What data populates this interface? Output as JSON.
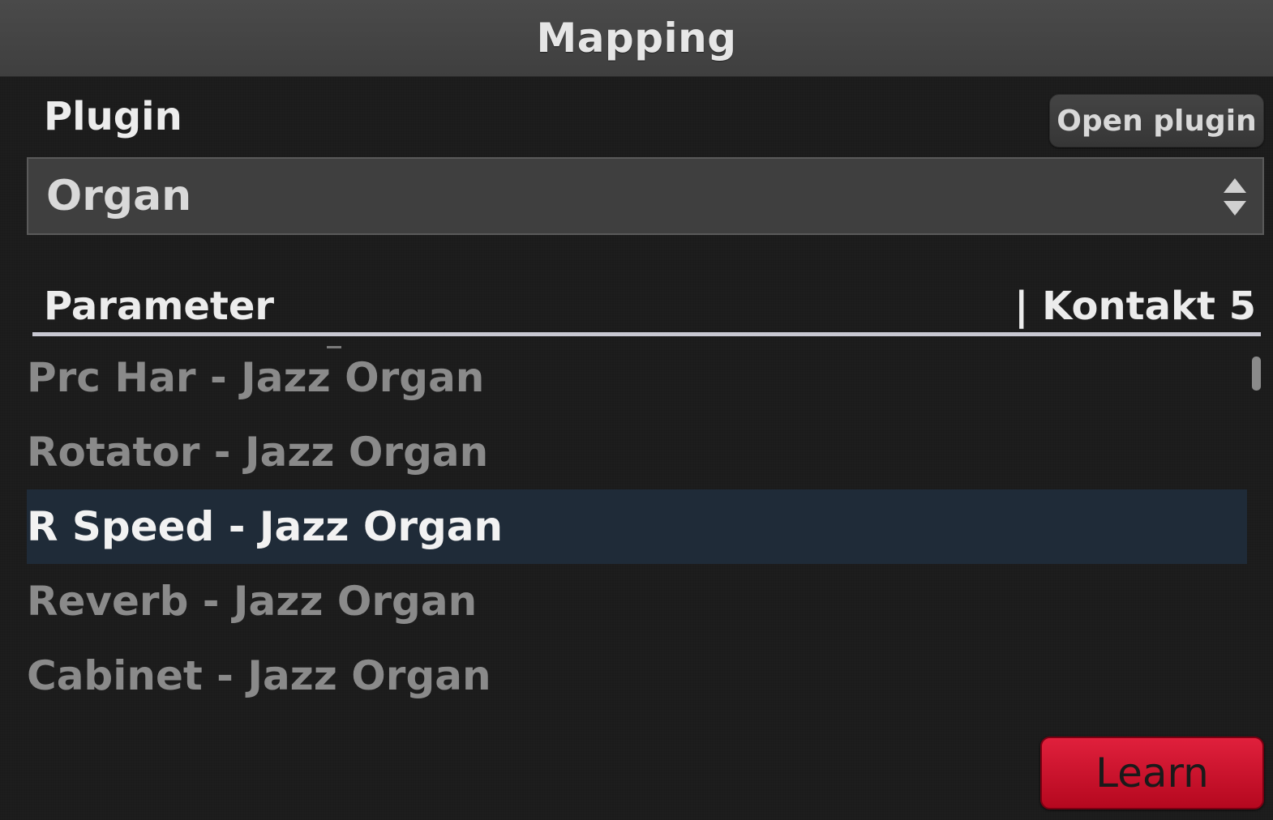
{
  "window": {
    "title": "Mapping"
  },
  "plugin": {
    "label": "Plugin",
    "open_button": "Open plugin",
    "selected": "Organ"
  },
  "parameters": {
    "column_label": "Parameter",
    "source_label": "| Kontakt 5",
    "items": [
      {
        "label": "Prc Har - Jazz Organ",
        "selected": false
      },
      {
        "label": "Rotator - Jazz Organ",
        "selected": false
      },
      {
        "label": "R Speed - Jazz Organ",
        "selected": true
      },
      {
        "label": "Reverb - Jazz Organ",
        "selected": false
      },
      {
        "label": "Cabinet - Jazz Organ",
        "selected": false
      }
    ]
  },
  "actions": {
    "learn": "Learn"
  },
  "colors": {
    "accent_red": "#c8102e",
    "selection": "#1f2b38",
    "background": "#1b1b1b"
  }
}
